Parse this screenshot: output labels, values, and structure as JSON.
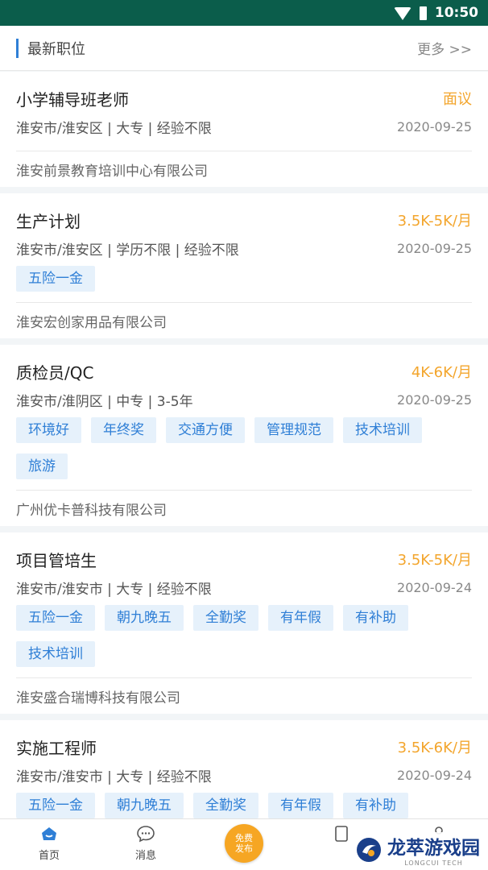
{
  "status_bar": {
    "time": "10:50"
  },
  "section": {
    "title": "最新职位",
    "more": "更多 >>"
  },
  "jobs": [
    {
      "title": "小学辅导班老师",
      "salary": "面议",
      "meta": "淮安市/淮安区 | 大专 | 经验不限",
      "date": "2020-09-25",
      "tags": [],
      "company": "淮安前景教育培训中心有限公司"
    },
    {
      "title": "生产计划",
      "salary": "3.5K-5K/月",
      "meta": "淮安市/淮安区 | 学历不限 | 经验不限",
      "date": "2020-09-25",
      "tags": [
        "五险一金"
      ],
      "company": "淮安宏创家用品有限公司"
    },
    {
      "title": "质检员/QC",
      "salary": "4K-6K/月",
      "meta": "淮安市/淮阴区 | 中专 | 3-5年",
      "date": "2020-09-25",
      "tags": [
        "环境好",
        "年终奖",
        "交通方便",
        "管理规范",
        "技术培训",
        "旅游"
      ],
      "company": "广州优卡普科技有限公司"
    },
    {
      "title": "项目管培生",
      "salary": "3.5K-5K/月",
      "meta": "淮安市/淮安市 | 大专 | 经验不限",
      "date": "2020-09-24",
      "tags": [
        "五险一金",
        "朝九晚五",
        "全勤奖",
        "有年假",
        "有补助",
        "技术培训"
      ],
      "company": "淮安盛合瑞博科技有限公司"
    },
    {
      "title": "实施工程师",
      "salary": "3.5K-6K/月",
      "meta": "淮安市/淮安市 | 大专 | 经验不限",
      "date": "2020-09-24",
      "tags": [
        "五险一金",
        "朝九晚五",
        "全勤奖",
        "有年假",
        "有补助"
      ],
      "company": ""
    }
  ],
  "tabbar": {
    "home": "首页",
    "messages": "消息",
    "publish_line1": "免费",
    "publish_line2": "发布",
    "colors": {
      "active": "#2f7fd6",
      "publish": "#f6a623"
    }
  },
  "watermark": {
    "main": "龙萃游戏园",
    "sub": "LONGCUI TECH"
  },
  "colors": {
    "status_bar": "#0b5d4b",
    "salary": "#f3a52c",
    "tag_text": "#2f7fd6",
    "tag_bg": "#e6f1fb"
  }
}
